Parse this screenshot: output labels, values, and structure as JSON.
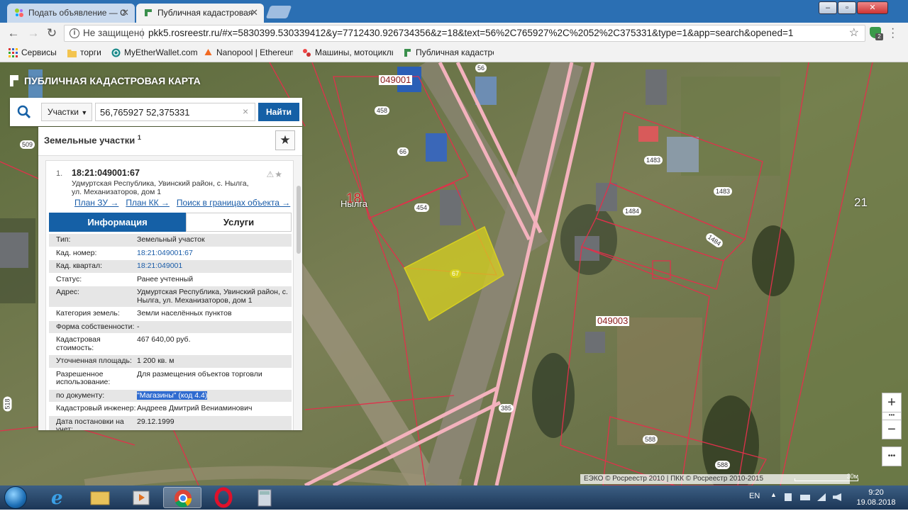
{
  "browser": {
    "tabs": [
      {
        "title": "Подать объявление — С",
        "active": false
      },
      {
        "title": "Публичная кадастровая",
        "active": true
      }
    ],
    "window_controls": [
      "–",
      "▫",
      "✕"
    ],
    "address": {
      "security_label": "Не защищено",
      "url": "pkk5.rosreestr.ru/#x=5830399.530339412&y=7712430.926734356&z=18&text=56%2C765927%2C%2052%2C375331&type=1&app=search&opened=1"
    },
    "extension_badge": "2",
    "bookmarks": [
      {
        "label": "Сервисы",
        "icon": "apps-icon"
      },
      {
        "label": "торги",
        "icon": "folder-icon"
      },
      {
        "label": "MyEtherWallet.com",
        "icon": "myetherwallet-icon"
      },
      {
        "label": "Nanopool | Ethereum",
        "icon": "nanopool-icon"
      },
      {
        "label": "Машины, мотоциклы",
        "icon": "cars-icon"
      },
      {
        "label": "Публичная кадастров",
        "icon": "rosreestr-icon"
      }
    ]
  },
  "app": {
    "brand": "ПУБЛИЧНАЯ КАДАСТРОВАЯ КАРТА",
    "search": {
      "type": "Участки",
      "query": "56,765927 52,375331",
      "clear": "×",
      "button": "Найти"
    },
    "result": {
      "title": "Земельные участки",
      "count": "1",
      "fav": "★",
      "item": {
        "index": "1.",
        "cad_number": "18:21:049001:67",
        "address_line1": "Удмуртская Республика, Увинский район, с. Нылга,",
        "address_line2": "ул. Механизаторов, дом 1",
        "links": [
          "План ЗУ →",
          "План КК →",
          "Поиск в границах объекта →"
        ],
        "icons": "⚠★"
      },
      "tabs": {
        "info": "Информация",
        "services": "Услуги"
      },
      "properties": [
        {
          "k": "Тип:",
          "v": "Земельный участок",
          "link": false
        },
        {
          "k": "Кад. номер:",
          "v": "18:21:049001:67",
          "link": true
        },
        {
          "k": "Кад. квартал:",
          "v": "18:21:049001",
          "link": true
        },
        {
          "k": "Статус:",
          "v": "Ранее учтенный",
          "link": false
        },
        {
          "k": "Адрес:",
          "v": "Удмуртская Республика, Увинский район, с. Нылга, ул. Механизаторов, дом 1",
          "link": false
        },
        {
          "k": "Категория земель:",
          "v": "Земли населённых пунктов",
          "link": false
        },
        {
          "k": "Форма собственности:",
          "v": "-",
          "link": false
        },
        {
          "k": "Кадастровая стоимость:",
          "v": "467 640,00 руб.",
          "link": false
        },
        {
          "k": "Уточненная площадь:",
          "v": "1 200 кв. м",
          "link": false
        },
        {
          "k": "Разрешенное использование:",
          "v": "Для размещения объектов торговли",
          "link": false
        },
        {
          "k": "по документу:",
          "v": "\"Магазины\" (код 4.4)",
          "link": false,
          "highlight": true
        },
        {
          "k": "Кадастровый инженер:",
          "v": "Андреев Дмитрий Вениаминович",
          "link": false
        },
        {
          "k": "Дата постановки на учет:",
          "v": "29.12.1999",
          "link": false
        }
      ]
    },
    "map_labels": {
      "quarters": [
        "049001",
        "049003"
      ],
      "parcels": [
        "458",
        "66",
        "454",
        "67",
        "1483",
        "1483",
        "1484",
        "1484",
        "385",
        "588",
        "588",
        "509",
        "518",
        "56"
      ],
      "place_name": "Нылга",
      "block_number": "18",
      "big_21": "21"
    },
    "controls": {
      "zoom_in": "+",
      "zoom_out": "−",
      "more": "•••"
    },
    "attribution": "ЕЭКО © Росреестр 2010 | ПКК © Росреестр 2010-2015",
    "scale": "30м"
  },
  "taskbar": {
    "lang": "EN",
    "time": "9:20",
    "date": "19.08.2018"
  },
  "colors": {
    "chrome_blue": "#2b6fb3",
    "pkk_blue": "#1560a6",
    "parcel_border": "#e0314b",
    "selected_parcel": "#d7d020"
  }
}
